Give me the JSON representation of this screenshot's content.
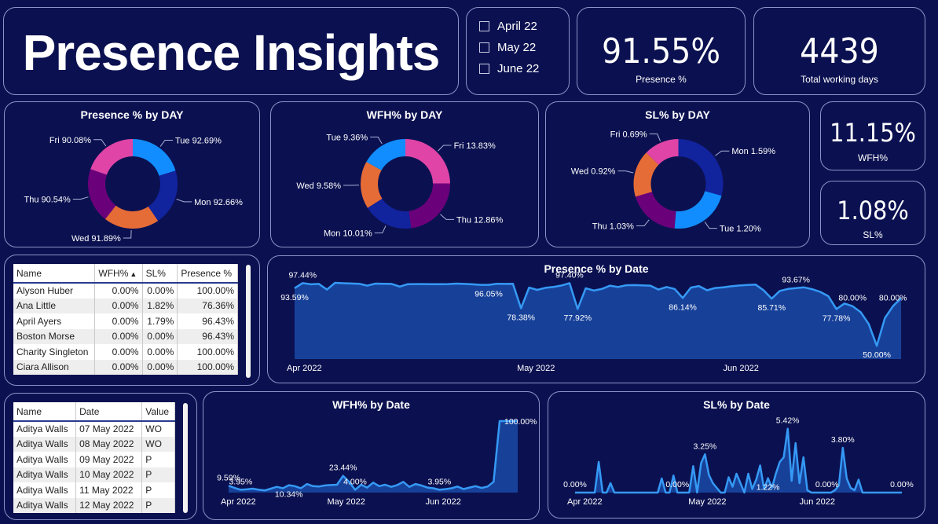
{
  "title": "Presence Insights",
  "months": [
    "April 22",
    "May 22",
    "June 22"
  ],
  "kpis": {
    "presence": {
      "value": "91.55%",
      "label": "Presence %"
    },
    "working_days": {
      "value": "4439",
      "label": "Total working days"
    },
    "wfh": {
      "value": "11.15%",
      "label": "WFH%"
    },
    "sl": {
      "value": "1.08%",
      "label": "SL%"
    }
  },
  "table1": {
    "headers": [
      "Name",
      "WFH%",
      "SL%",
      "Presence %"
    ],
    "rows": [
      [
        "Alyson Huber",
        "0.00%",
        "0.00%",
        "100.00%"
      ],
      [
        "Ana Little",
        "0.00%",
        "1.82%",
        "76.36%"
      ],
      [
        "April Ayers",
        "0.00%",
        "1.79%",
        "96.43%"
      ],
      [
        "Boston Morse",
        "0.00%",
        "0.00%",
        "96.43%"
      ],
      [
        "Charity Singleton",
        "0.00%",
        "0.00%",
        "100.00%"
      ],
      [
        "Ciara Allison",
        "0.00%",
        "0.00%",
        "100.00%"
      ]
    ]
  },
  "table2": {
    "headers": [
      "Name",
      "Date",
      "Value"
    ],
    "rows": [
      [
        "Aditya Walls",
        "07 May 2022",
        "WO"
      ],
      [
        "Aditya Walls",
        "08 May 2022",
        "WO"
      ],
      [
        "Aditya Walls",
        "09 May 2022",
        "P"
      ],
      [
        "Aditya Walls",
        "10 May 2022",
        "P"
      ],
      [
        "Aditya Walls",
        "11 May 2022",
        "P"
      ],
      [
        "Aditya Walls",
        "12 May 2022",
        "P"
      ]
    ]
  },
  "colors": {
    "blue": "#118dff",
    "navy": "#12239e",
    "orange": "#e66c37",
    "purple": "#6b007b",
    "pink": "#e044a7",
    "line": "#3599f5",
    "area": "#1a4aa6"
  },
  "chart_data": [
    {
      "type": "pie",
      "title": "Presence % by DAY",
      "slices": [
        {
          "day": "Tue",
          "label": "Tue 92.69%",
          "value": 92.69,
          "color": "#118dff"
        },
        {
          "day": "Mon",
          "label": "Mon 92.66%",
          "value": 92.66,
          "color": "#12239e"
        },
        {
          "day": "Wed",
          "label": "Wed 91.89%",
          "value": 91.89,
          "color": "#e66c37"
        },
        {
          "day": "Thu",
          "label": "Thu 90.54%",
          "value": 90.54,
          "color": "#6b007b"
        },
        {
          "day": "Fri",
          "label": "Fri 90.08%",
          "value": 90.08,
          "color": "#e044a7"
        }
      ]
    },
    {
      "type": "pie",
      "title": "WFH% by DAY",
      "slices": [
        {
          "day": "Fri",
          "label": "Fri 13.83%",
          "value": 13.83,
          "color": "#e044a7"
        },
        {
          "day": "Thu",
          "label": "Thu 12.86%",
          "value": 12.86,
          "color": "#6b007b"
        },
        {
          "day": "Mon",
          "label": "Mon 10.01%",
          "value": 10.01,
          "color": "#12239e"
        },
        {
          "day": "Wed",
          "label": "Wed 9.58%",
          "value": 9.58,
          "color": "#e66c37"
        },
        {
          "day": "Tue",
          "label": "Tue 9.36%",
          "value": 9.36,
          "color": "#118dff"
        }
      ]
    },
    {
      "type": "pie",
      "title": "SL% by DAY",
      "slices": [
        {
          "day": "Mon",
          "label": "Mon 1.59%",
          "value": 1.59,
          "color": "#12239e"
        },
        {
          "day": "Tue",
          "label": "Tue 1.20%",
          "value": 1.2,
          "color": "#118dff"
        },
        {
          "day": "Thu",
          "label": "Thu 1.03%",
          "value": 1.03,
          "color": "#6b007b"
        },
        {
          "day": "Wed",
          "label": "Wed 0.92%",
          "value": 0.92,
          "color": "#e66c37"
        },
        {
          "day": "Fri",
          "label": "Fri 0.69%",
          "value": 0.69,
          "color": "#e044a7"
        }
      ]
    },
    {
      "type": "area",
      "title": "Presence % by Date",
      "x_ticks": [
        "Apr 2022",
        "May 2022",
        "Jun 2022"
      ],
      "ylim": [
        40,
        100
      ],
      "values": [
        93.59,
        97.44,
        96.5,
        96.8,
        92.5,
        97.6,
        97.3,
        97.1,
        96.9,
        95.5,
        97.0,
        96.9,
        96.8,
        94.8,
        96.6,
        96.7,
        96.7,
        96.6,
        96.6,
        96.7,
        97.0,
        96.8,
        96.5,
        96.1,
        96.05,
        96.9,
        96.8,
        96.9,
        78.38,
        94.0,
        92.3,
        93.8,
        94.5,
        95.6,
        97.4,
        77.92,
        93.5,
        91.8,
        93.0,
        95.5,
        94.5,
        95.8,
        95.9,
        95.7,
        95.5,
        92.5,
        94.5,
        93.0,
        86.14,
        94.0,
        95.2,
        92.0,
        93.7,
        94.2,
        95.0,
        95.6,
        96.0,
        96.3,
        92.0,
        85.71,
        91.5,
        93.0,
        93.67,
        94.2,
        92.8,
        90.8,
        87.5,
        77.78,
        82.0,
        80.0,
        75.5,
        66.5,
        50.0,
        71.0,
        80.0,
        86.0
      ],
      "labels": [
        {
          "i": 0,
          "text": "93.59%",
          "pos": "below"
        },
        {
          "i": 1,
          "text": "97.44%",
          "pos": "above"
        },
        {
          "i": 24,
          "text": "96.05%",
          "pos": "below"
        },
        {
          "i": 28,
          "text": "78.38%",
          "pos": "below"
        },
        {
          "i": 34,
          "text": "97.40%",
          "pos": "above"
        },
        {
          "i": 35,
          "text": "77.92%",
          "pos": "below"
        },
        {
          "i": 48,
          "text": "86.14%",
          "pos": "below"
        },
        {
          "i": 59,
          "text": "85.71%",
          "pos": "below"
        },
        {
          "i": 62,
          "text": "93.67%",
          "pos": "above"
        },
        {
          "i": 67,
          "text": "77.78%",
          "pos": "below"
        },
        {
          "i": 69,
          "text": "80.00%",
          "pos": "above"
        },
        {
          "i": 72,
          "text": "50.00%",
          "pos": "below"
        },
        {
          "i": 74,
          "text": "80.00%",
          "pos": "above"
        }
      ]
    },
    {
      "type": "area",
      "title": "WFH% by Date",
      "x_ticks": [
        "Apr 2022",
        "May 2022",
        "Jun 2022"
      ],
      "ylim": [
        0,
        100
      ],
      "values": [
        9.59,
        6.5,
        3.95,
        4.5,
        5.5,
        4.0,
        3.0,
        5.5,
        8.0,
        6.0,
        10.34,
        9.0,
        6.0,
        12.0,
        9.0,
        8.5,
        10.0,
        10.5,
        11.0,
        23.44,
        15.0,
        4.0,
        11.0,
        7.0,
        14.0,
        9.0,
        11.0,
        8.0,
        10.5,
        15.0,
        8.0,
        12.0,
        10.0,
        7.0,
        6.0,
        3.95,
        4.8,
        6.0,
        8.5,
        5.0,
        7.0,
        9.0,
        6.5,
        8.5,
        15.0,
        100.0,
        100.0,
        100.0,
        100.0
      ],
      "labels": [
        {
          "i": 0,
          "text": "9.59%",
          "pos": "above"
        },
        {
          "i": 2,
          "text": "3.95%",
          "pos": "above"
        },
        {
          "i": 10,
          "text": "10.34%",
          "pos": "below"
        },
        {
          "i": 19,
          "text": "23.44%",
          "pos": "above"
        },
        {
          "i": 21,
          "text": "4.00%",
          "pos": "above"
        },
        {
          "i": 35,
          "text": "3.95%",
          "pos": "above"
        },
        {
          "i": 45,
          "text": "100.00%",
          "pos": "right"
        }
      ]
    },
    {
      "type": "area",
      "title": "SL% by Date",
      "x_ticks": [
        "Apr 2022",
        "May 2022",
        "Jun 2022"
      ],
      "ylim": [
        0,
        6
      ],
      "values": [
        0.0,
        0.0,
        0.0,
        0.0,
        0.0,
        0.0,
        2.6,
        0.0,
        0.0,
        0.8,
        0.0,
        0.0,
        0.0,
        0.0,
        0.0,
        0.0,
        0.0,
        0.0,
        0.0,
        0.0,
        0.0,
        0.0,
        1.2,
        0.0,
        0.0,
        1.45,
        0.0,
        0.0,
        0.0,
        0.0,
        2.25,
        0.0,
        2.5,
        3.25,
        1.5,
        0.8,
        0.4,
        0.0,
        0.0,
        1.3,
        0.5,
        1.6,
        0.8,
        0.0,
        1.6,
        0.3,
        1.1,
        2.3,
        0.3,
        1.22,
        0.4,
        1.6,
        2.6,
        3.0,
        5.42,
        1.0,
        4.2,
        0.8,
        3.0,
        0.2,
        0.0,
        0.0,
        0.0,
        0.0,
        0.0,
        0.0,
        0.2,
        0.6,
        3.8,
        1.2,
        0.4,
        0.2,
        1.1,
        0.0,
        0.0,
        0.0,
        0.0,
        0.0,
        0.0,
        0.0,
        0.0,
        0.0,
        0.0,
        0.0
      ],
      "labels": [
        {
          "i": 0,
          "text": "0.00%",
          "pos": "above"
        },
        {
          "i": 26,
          "text": "0.00%",
          "pos": "above"
        },
        {
          "i": 33,
          "text": "3.25%",
          "pos": "above"
        },
        {
          "i": 49,
          "text": "1.22%",
          "pos": "below"
        },
        {
          "i": 54,
          "text": "5.42%",
          "pos": "above"
        },
        {
          "i": 64,
          "text": "0.00%",
          "pos": "above"
        },
        {
          "i": 68,
          "text": "3.80%",
          "pos": "above"
        },
        {
          "i": 83,
          "text": "0.00%",
          "pos": "above"
        }
      ]
    }
  ]
}
